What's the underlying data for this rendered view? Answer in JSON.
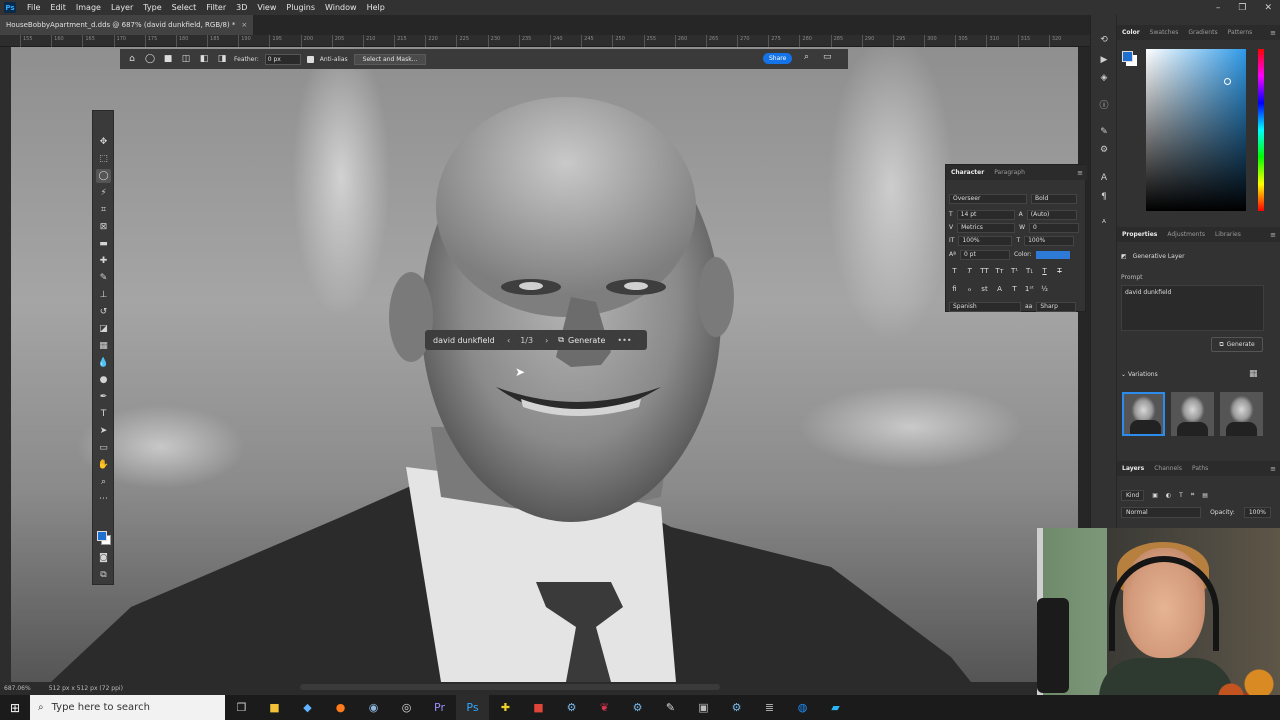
{
  "menubar": {
    "logo": "Ps",
    "items": [
      "File",
      "Edit",
      "Image",
      "Layer",
      "Type",
      "Select",
      "Filter",
      "3D",
      "View",
      "Plugins",
      "Window",
      "Help"
    ],
    "window_controls": [
      "–",
      "❐",
      "✕"
    ]
  },
  "document": {
    "tab_title": "HouseBobbyApartment_d.dds @ 687% (david dunkfield, RGB/8) *",
    "close": "×"
  },
  "ruler": {
    "ticks": [
      "155",
      "160",
      "165",
      "170",
      "175",
      "180",
      "185",
      "190",
      "195",
      "200",
      "205",
      "210",
      "215",
      "220",
      "225",
      "230",
      "235",
      "240",
      "245",
      "250",
      "255",
      "260",
      "265",
      "270",
      "275",
      "280",
      "285",
      "290",
      "295",
      "300",
      "305",
      "310",
      "315",
      "320"
    ]
  },
  "options_bar": {
    "feather_label": "Feather:",
    "feather_value": "0 px",
    "antialias_label": "Anti-alias",
    "select_mask_label": "Select and Mask...",
    "share_label": "Share"
  },
  "context_bar": {
    "prompt": "david dunkfield",
    "count": "1/3",
    "generate_label": "Generate",
    "more": "•••"
  },
  "color_panel": {
    "tabs": [
      "Color",
      "Swatches",
      "Gradients",
      "Patterns"
    ],
    "foreground": "#1e6fd0",
    "background": "#ffffff"
  },
  "properties_panel": {
    "tabs": [
      "Properties",
      "Adjustments",
      "Libraries"
    ],
    "layer_type": "Generative Layer",
    "prompt_label": "Prompt",
    "prompt_value": "david dunkfield",
    "generate_label": "Generate",
    "variations_label": "Variations"
  },
  "layers_panel": {
    "tabs": [
      "Layers",
      "Channels",
      "Paths"
    ],
    "filter_kind": "Kind",
    "blend_mode": "Normal",
    "opacity_label": "Opacity:",
    "opacity_value": "100%"
  },
  "character_panel": {
    "tabs": [
      "Character",
      "Paragraph"
    ],
    "font_family": "Overseer",
    "font_style": "Bold",
    "font_size": "14 pt",
    "leading": "(Auto)",
    "kerning": "Metrics",
    "tracking": "0",
    "vertical_scale": "100%",
    "horizontal_scale": "100%",
    "baseline_shift": "0 pt",
    "color_label": "Color:",
    "language": "Spanish",
    "antialias": "Sharp"
  },
  "status_bar": {
    "zoom": "687.06%",
    "doc_size": "512 px x 512 px (72 ppi)"
  },
  "windows_taskbar": {
    "search_placeholder": "Type here to search"
  }
}
